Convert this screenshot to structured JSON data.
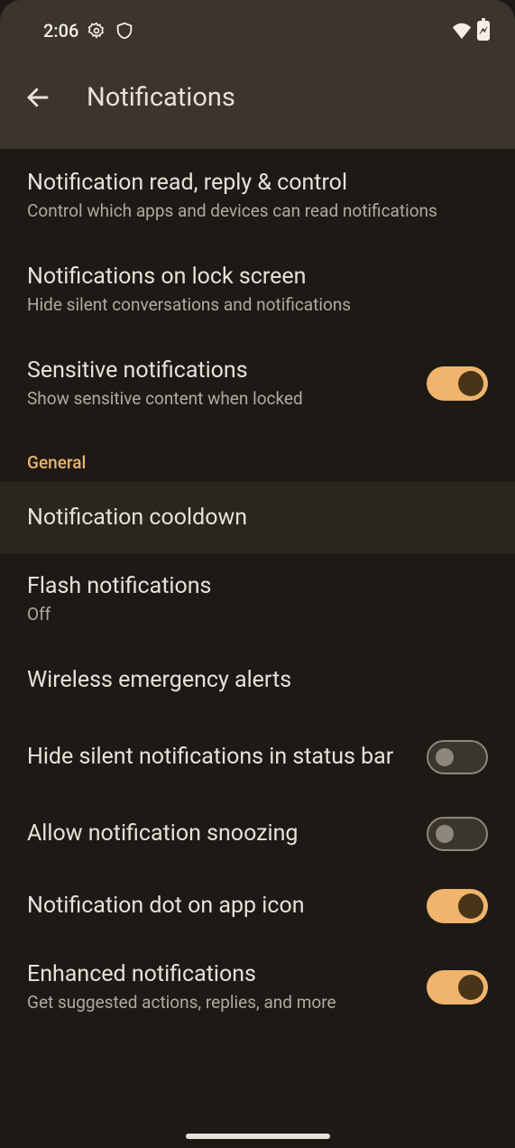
{
  "statusbar": {
    "time": "2:06"
  },
  "appbar": {
    "title": "Notifications"
  },
  "sections": {
    "privacy": [
      {
        "title": "Notification read, reply & control",
        "sub": "Control which apps and devices can read notifications"
      },
      {
        "title": "Notifications on lock screen",
        "sub": "Hide silent conversations and notifications"
      },
      {
        "title": "Sensitive notifications",
        "sub": "Show sensitive content when locked",
        "toggle": true
      }
    ],
    "general_label": "General",
    "general": [
      {
        "title": "Notification cooldown",
        "highlight": true
      },
      {
        "title": "Flash notifications",
        "sub": "Off"
      },
      {
        "title": "Wireless emergency alerts"
      },
      {
        "title": "Hide silent notifications in status bar",
        "toggle": false
      },
      {
        "title": "Allow notification snoozing",
        "toggle": false
      },
      {
        "title": "Notification dot on app icon",
        "toggle": true
      },
      {
        "title": "Enhanced notifications",
        "sub": "Get suggested actions, replies, and more",
        "toggle": true
      }
    ]
  }
}
